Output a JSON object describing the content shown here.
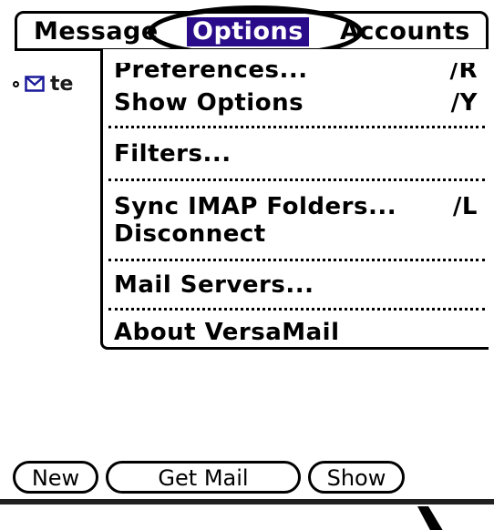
{
  "menubar": {
    "titles": [
      "Message",
      "Options",
      "Accounts"
    ],
    "active_index": 1,
    "active_color": "#2a0b8a"
  },
  "message_list": {
    "items": [
      {
        "icon": "envelope-icon",
        "subject": "te"
      }
    ]
  },
  "options_menu": {
    "items": [
      {
        "label": "Preferences...",
        "shortcut": "∕R"
      },
      {
        "label": "Show Options",
        "shortcut": "∕Y"
      },
      {
        "label": "Filters..."
      },
      {
        "label": "Sync IMAP Folders...",
        "shortcut": "∕L"
      },
      {
        "label": "Disconnect"
      },
      {
        "label": "Mail Servers..."
      },
      {
        "label": "About VersaMail"
      }
    ]
  },
  "buttons": {
    "new": "New",
    "get_mail": "Get Mail",
    "show": "Show"
  }
}
